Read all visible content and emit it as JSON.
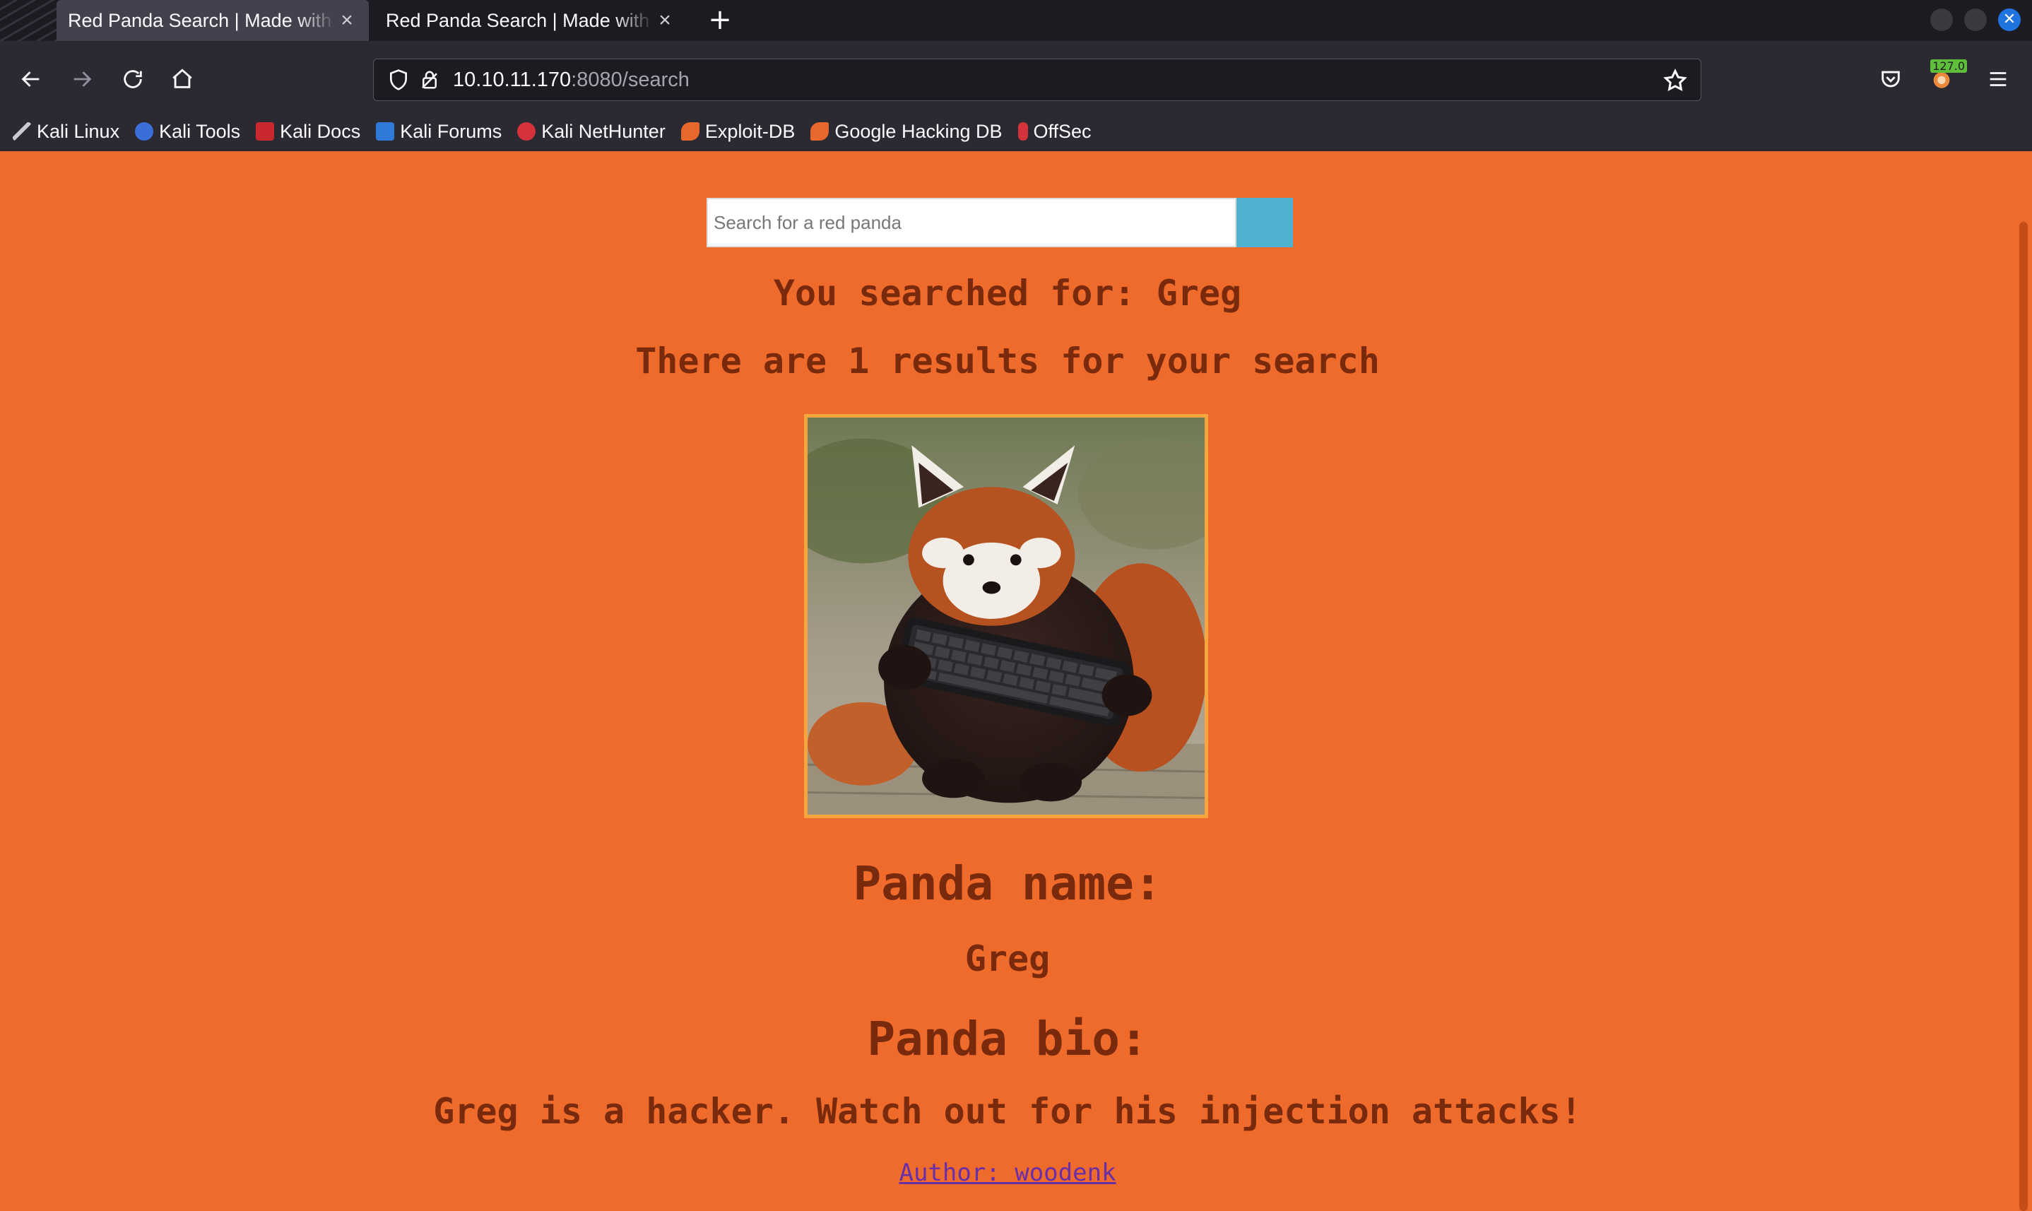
{
  "browser": {
    "tabs": [
      {
        "title": "Red Panda Search | Made with Spring Boot",
        "active": true
      },
      {
        "title": "Red Panda Search | Made with Spring Boot",
        "active": false
      }
    ],
    "url": {
      "host": "10.10.11.170",
      "path": ":8080/search"
    },
    "badge": "127.0",
    "bookmarks": [
      {
        "label": "Kali Linux",
        "icon": "kali-dragon-icon"
      },
      {
        "label": "Kali Tools",
        "icon": "kali-tools-icon"
      },
      {
        "label": "Kali Docs",
        "icon": "kali-docs-icon"
      },
      {
        "label": "Kali Forums",
        "icon": "kali-forums-icon"
      },
      {
        "label": "Kali NetHunter",
        "icon": "nethunter-icon"
      },
      {
        "label": "Exploit-DB",
        "icon": "exploitdb-icon"
      },
      {
        "label": "Google Hacking DB",
        "icon": "ghdb-icon"
      },
      {
        "label": "OffSec",
        "icon": "offsec-icon"
      }
    ]
  },
  "page": {
    "search": {
      "placeholder": "Search for a red panda",
      "value": ""
    },
    "searched_text": "You searched for: Greg",
    "results_text": "There are 1 results for your search",
    "image_alt": "red panda holding a keyboard",
    "panda_name_label": "Panda name:",
    "panda_name": "Greg",
    "panda_bio_label": "Panda bio:",
    "panda_bio": "Greg is a hacker. Watch out for his injection attacks!",
    "author_link": "Author: woodenk"
  },
  "colors": {
    "page_background": "#ee6b2c",
    "heading_text": "#7a2a0c",
    "search_button": "#4fb3cf",
    "image_border": "#f7a53c",
    "link": "#6a2ea8"
  }
}
